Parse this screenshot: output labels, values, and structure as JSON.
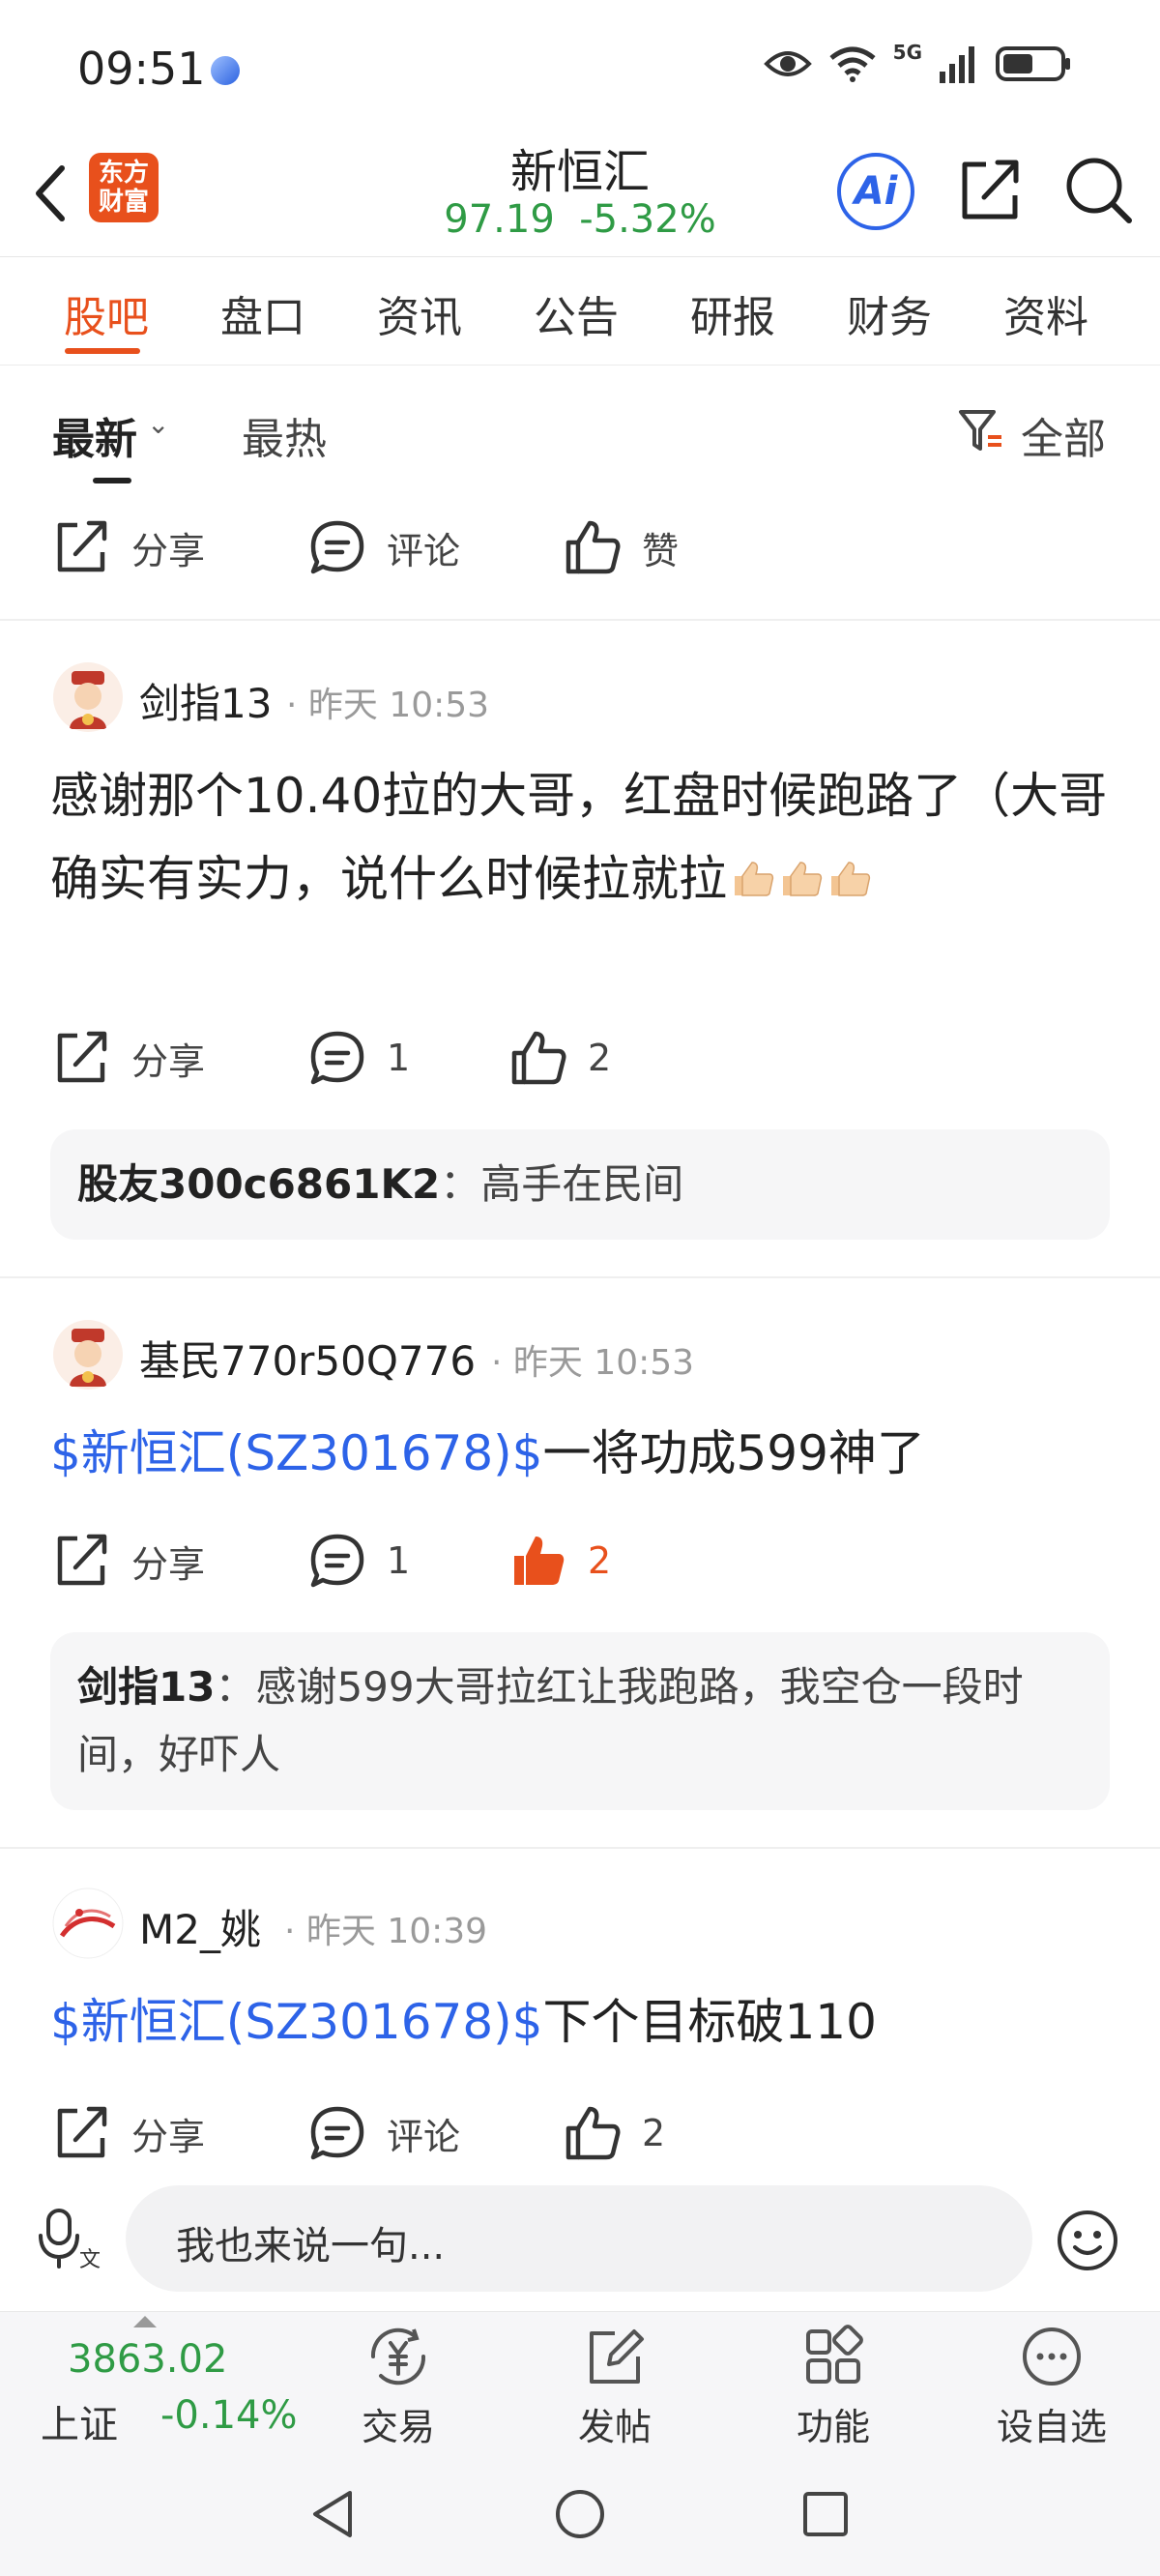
{
  "status_bar": {
    "time": "09:51",
    "network": "5G"
  },
  "header": {
    "logo_text": "东方\n财富",
    "stock_name": "新恒汇",
    "stock_price": "97.19  -5.32%",
    "ai_label": "Ai"
  },
  "tabs": [
    "股吧",
    "盘口",
    "资讯",
    "公告",
    "研报",
    "财务",
    "资料"
  ],
  "sort": {
    "latest": "最新",
    "hot": "最热",
    "filter": "全部"
  },
  "actions_common": {
    "share": "分享",
    "comment": "评论",
    "like": "赞"
  },
  "top_actions": {
    "share": "分享",
    "comment": "评论",
    "like": "赞"
  },
  "posts": [
    {
      "user": "剑指13",
      "time": "· 昨天 10:53",
      "text": "感谢那个10.40拉的大哥，红盘时候跑路了（大哥确实有实力，说什么时候拉就拉",
      "share": "分享",
      "comments": "1",
      "likes": "2",
      "reply_user": "股友300c6861K2",
      "reply_text": "：高手在民间"
    },
    {
      "user": "基民770r50Q776",
      "time": "· 昨天 10:53",
      "tag": "$新恒汇(SZ301678)$",
      "text": "一将功成599神了",
      "share": "分享",
      "comments": "1",
      "likes": "2",
      "reply_user": "剑指13",
      "reply_text": "：感谢599大哥拉红让我跑路，我空仓一段时间，好吓人"
    },
    {
      "user": "M2_姚",
      "time": "· 昨天 10:39",
      "tag": "$新恒汇(SZ301678)$",
      "text": "下个目标破110",
      "share": "分享",
      "comments": "评论",
      "likes": "2"
    }
  ],
  "input": {
    "placeholder": "我也来说一句..."
  },
  "bottom_nav": {
    "index_value": "3863.02",
    "index_name": "上证",
    "index_change": "-0.14%",
    "items": [
      "交易",
      "发帖",
      "功能",
      "设自选"
    ]
  },
  "colors": {
    "accent": "#e8501c",
    "green": "#2f9b45",
    "link": "#2d63e8"
  }
}
